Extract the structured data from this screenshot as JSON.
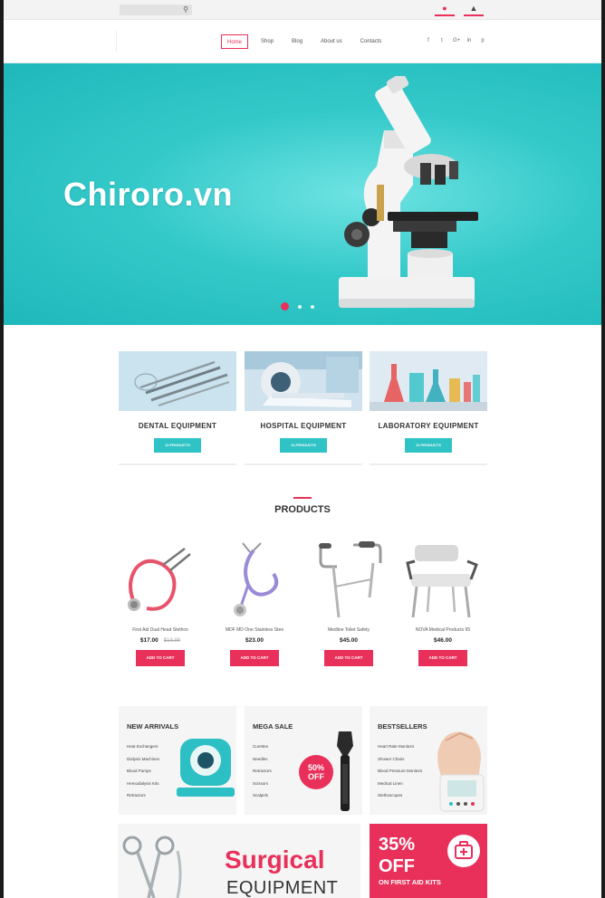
{
  "topbar": {
    "search_icon": "search-icon",
    "cart_icon": "cart-icon",
    "user_icon": "user-icon"
  },
  "nav": {
    "links": [
      "Home",
      "Shop",
      "Blog",
      "About us",
      "Contacts"
    ],
    "active_index": 0,
    "socials": [
      "f",
      "t",
      "G+",
      "in",
      "p"
    ]
  },
  "hero": {
    "title": "Chiroro.vn",
    "slides": 3,
    "active_slide": 0
  },
  "categories": [
    {
      "title": "DENTAL EQUIPMENT",
      "button": "11 PRODUCTS"
    },
    {
      "title": "HOSPITAL EQUIPMENT",
      "button": "11 PRODUCTS"
    },
    {
      "title": "LABORATORY EQUIPMENT",
      "button": "11 PRODUCTS"
    }
  ],
  "products_section": {
    "title": "PRODUCTS",
    "items": [
      {
        "name": "First Aid Dual Head Stethos",
        "price": "$17.00",
        "old_price": "$18.99",
        "button": "ADD TO CART"
      },
      {
        "name": "MDF MD One Stainless Stee",
        "price": "$23.00",
        "old_price": "",
        "button": "ADD TO CART"
      },
      {
        "name": "Medline Toilet Safety",
        "price": "$45.00",
        "old_price": "",
        "button": "ADD TO CART"
      },
      {
        "name": "NOVA Medical Products 95",
        "price": "$46.00",
        "old_price": "",
        "button": "ADD TO CART"
      }
    ]
  },
  "promos": [
    {
      "title": "NEW ARRIVALS",
      "items": [
        "Heat Exchangers",
        "Dialysis Machines",
        "Blood Pumps",
        "Hemodialysis Kits",
        "Retractors"
      ]
    },
    {
      "title": "MEGA SALE",
      "items": [
        "Curettes",
        "Needles",
        "Retractors",
        "Scissors",
        "Scalpels"
      ],
      "badge_pct": "50%",
      "badge_off": "OFF"
    },
    {
      "title": "BESTSELLERS",
      "items": [
        "Heart Rate Monitors",
        "Shower Chairs",
        "Blood Pressure Monitors",
        "Medical Linen",
        "Stethoscopes"
      ]
    }
  ],
  "banners": {
    "surgical_title": "Surgical",
    "surgical_sub": "EQUIPMENT",
    "offer_pct": "35%",
    "offer_off": "OFF",
    "offer_sub": "ON FIRST AID KITS"
  },
  "colors": {
    "accent": "#e8305a",
    "teal": "#2fc3c6",
    "hero_bg": "#34c9c9"
  }
}
